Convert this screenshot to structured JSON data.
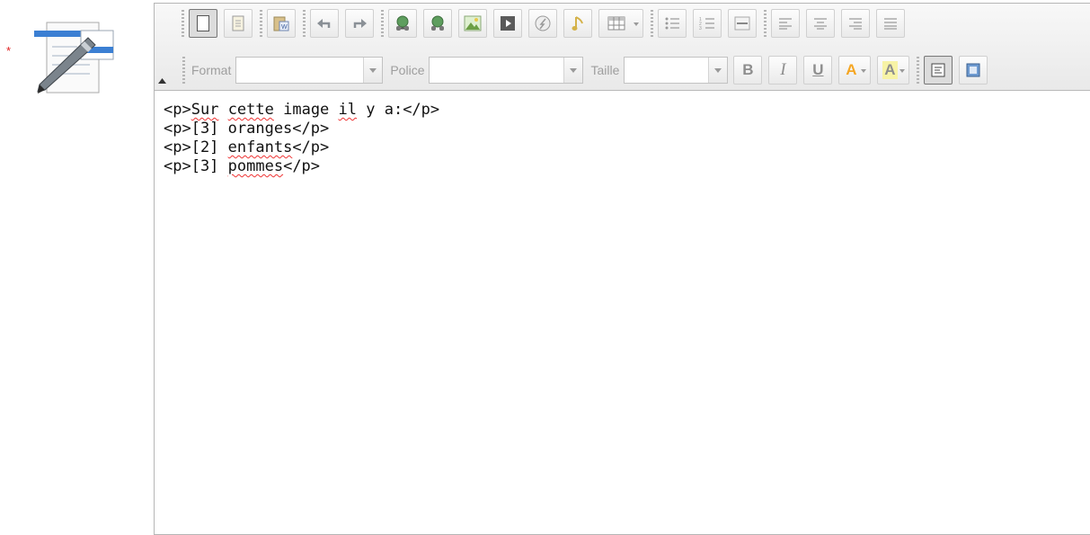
{
  "form": {
    "required_marker": "*"
  },
  "toolbar": {
    "row1_icons": [
      "new-page-icon",
      "templates-icon",
      "paste-word-icon",
      "undo-icon",
      "redo-icon",
      "link-icon",
      "unlink-icon",
      "image-icon",
      "media-icon",
      "flash-icon",
      "audio-icon",
      "table-icon",
      "bulleted-list-icon",
      "numbered-list-icon",
      "horizontal-rule-icon",
      "align-left-icon",
      "align-center-icon",
      "align-right-icon",
      "justify-icon"
    ],
    "format_label": "Format",
    "format_value": "",
    "font_label": "Police",
    "font_value": "",
    "size_label": "Taille",
    "size_value": "",
    "bold_label": "B",
    "italic_label": "I",
    "underline_label": "U",
    "text_color_label": "A",
    "bg_color_label": "A",
    "bg_color_hex": "#f7f3a6",
    "text_color_hex": "#f5a623"
  },
  "editor": {
    "lines": [
      [
        {
          "t": "<p>",
          "s": false
        },
        {
          "t": "Sur",
          "s": true
        },
        {
          "t": " ",
          "s": false
        },
        {
          "t": "cette",
          "s": true
        },
        {
          "t": " image ",
          "s": false
        },
        {
          "t": "il",
          "s": true
        },
        {
          "t": " y a:</p>",
          "s": false
        }
      ],
      [
        {
          "t": "<p>[3] oranges</p>",
          "s": false
        }
      ],
      [
        {
          "t": "<p>[2] ",
          "s": false
        },
        {
          "t": "enfants",
          "s": true
        },
        {
          "t": "</p>",
          "s": false
        }
      ],
      [
        {
          "t": "<p>[3] ",
          "s": false
        },
        {
          "t": "pommes",
          "s": true
        },
        {
          "t": "</p>",
          "s": false
        }
      ]
    ]
  }
}
